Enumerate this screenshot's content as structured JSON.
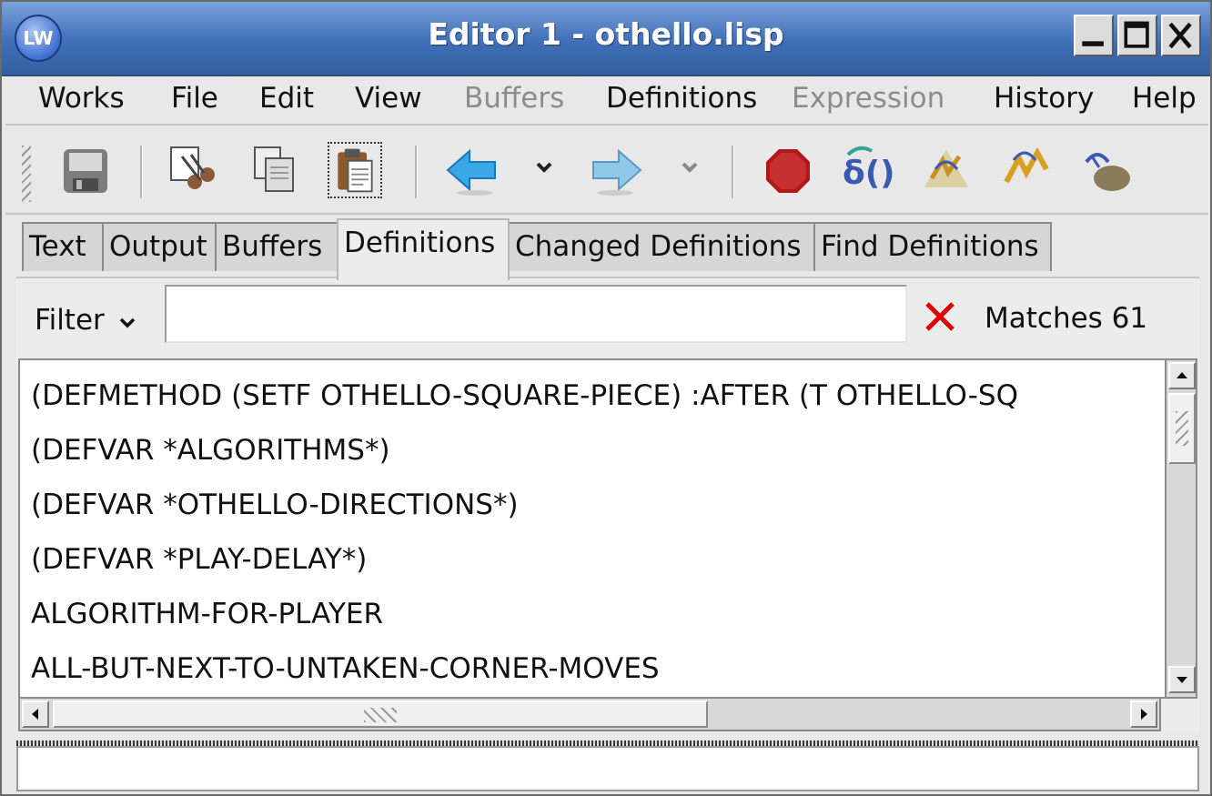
{
  "window": {
    "title": "Editor 1 - othello.lisp",
    "app_badge": "LW"
  },
  "menu": [
    {
      "label": "Works",
      "enabled": true
    },
    {
      "label": "File",
      "enabled": true
    },
    {
      "label": "Edit",
      "enabled": true
    },
    {
      "label": "View",
      "enabled": true
    },
    {
      "label": "Buffers",
      "enabled": false
    },
    {
      "label": "Definitions",
      "enabled": true
    },
    {
      "label": "Expression",
      "enabled": false
    },
    {
      "label": "History",
      "enabled": true
    },
    {
      "label": "Help",
      "enabled": true
    }
  ],
  "toolbar": {
    "icons": [
      "save-icon",
      "cut-icon",
      "copy-icon",
      "paste-icon",
      "back-arrow-icon",
      "forward-arrow-icon",
      "stop-icon",
      "evaluate-icon",
      "compile-icon",
      "compile-buffer-icon",
      "inspect-icon"
    ]
  },
  "tabs": [
    {
      "label": "Text",
      "active": false
    },
    {
      "label": "Output",
      "active": false
    },
    {
      "label": "Buffers",
      "active": false
    },
    {
      "label": "Definitions",
      "active": true
    },
    {
      "label": "Changed Definitions",
      "active": false
    },
    {
      "label": "Find Definitions",
      "active": false
    }
  ],
  "filter": {
    "label": "Filter",
    "value": "",
    "matches_text": "Matches 61"
  },
  "definitions": [
    "(DEFMETHOD (SETF OTHELLO-SQUARE-PIECE) :AFTER (T OTHELLO-SQ",
    "(DEFVAR *ALGORITHMS*)",
    "(DEFVAR *OTHELLO-DIRECTIONS*)",
    "(DEFVAR *PLAY-DELAY*)",
    "ALGORITHM-FOR-PLAYER",
    "ALL-BUT-NEXT-TO-UNTAKEN-CORNER-MOVES"
  ],
  "echo_area": "",
  "colors": {
    "titlebar": "#3f6fb8",
    "clear_x": "#e00000",
    "back_arrow": "#3aa8e8",
    "forward_arrow": "#8fc8e8",
    "stop": "#b01818"
  }
}
